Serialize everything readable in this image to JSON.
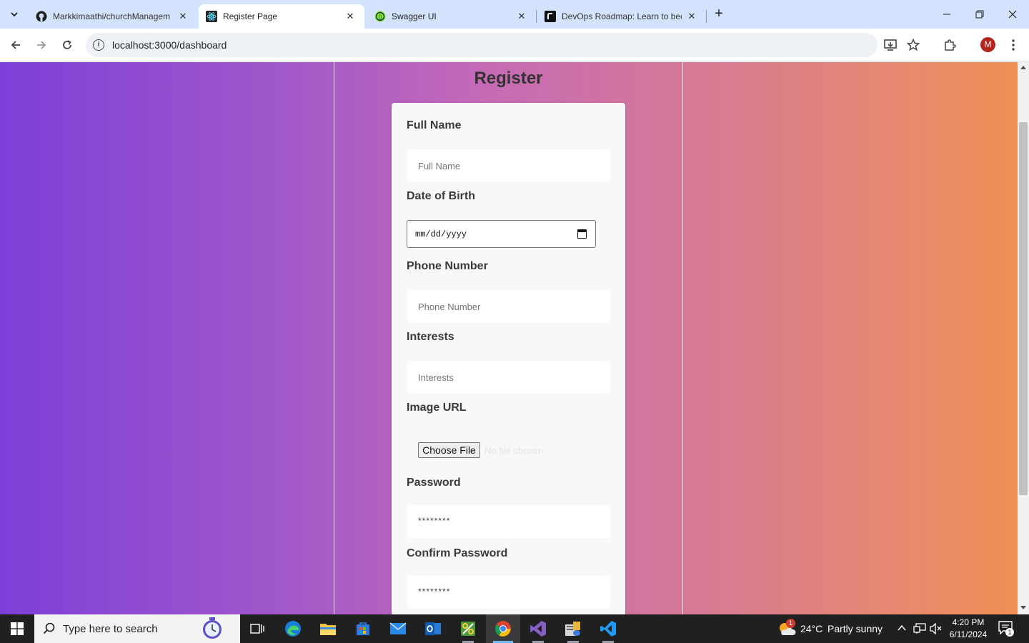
{
  "browser": {
    "tabs": [
      {
        "title": "Markkimaathi/churchManagem",
        "icon": "github-icon",
        "active": false
      },
      {
        "title": "Register Page",
        "icon": "react-icon",
        "active": true
      },
      {
        "title": "Swagger UI",
        "icon": "swagger-icon",
        "active": false
      },
      {
        "title": "DevOps Roadmap: Learn to bec",
        "icon": "roadmap-icon",
        "active": false
      }
    ],
    "url": "localhost:3000/dashboard",
    "profile_initial": "M"
  },
  "page": {
    "title": "Register",
    "fields": {
      "full_name": {
        "label": "Full Name",
        "placeholder": "Full Name"
      },
      "dob": {
        "label": "Date of Birth",
        "placeholder": "mm/dd/yyyy"
      },
      "phone": {
        "label": "Phone Number",
        "placeholder": "Phone Number"
      },
      "interests": {
        "label": "Interests",
        "placeholder": "Interests"
      },
      "image": {
        "label": "Image URL",
        "button": "Choose File",
        "status": "No file chosen"
      },
      "password": {
        "label": "Password",
        "placeholder": "********"
      },
      "confirm_password": {
        "label": "Confirm Password",
        "placeholder": "********"
      }
    }
  },
  "taskbar": {
    "search_placeholder": "Type here to search",
    "weather": {
      "temp": "24°C",
      "condition": "Partly sunny",
      "badge": "1"
    },
    "time": "4:20 PM",
    "date": "6/11/2024",
    "notification_count": "1"
  },
  "colors": {
    "gradient_start": "#7e3fd8",
    "gradient_end": "#f08f55",
    "tabstrip": "#d3e3fd",
    "taskbar": "#202020"
  }
}
